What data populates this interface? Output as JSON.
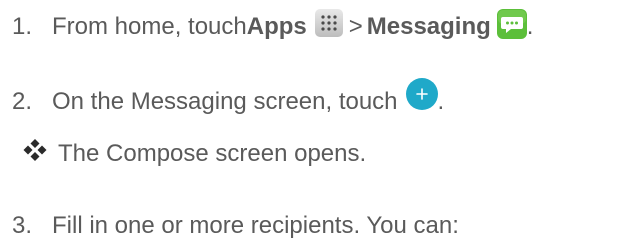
{
  "steps": [
    {
      "number": "1.",
      "text_before": "From home, touch ",
      "bold_1": "Apps",
      "separator": " > ",
      "bold_2": "Messaging",
      "trail": "."
    },
    {
      "number": "2.",
      "text_before": "On the Messaging screen, touch ",
      "trail": "."
    },
    {
      "number": "3.",
      "text": "Fill in one or more recipients. You can:"
    }
  ],
  "bullet": {
    "text": "The Compose screen opens."
  },
  "icons": {
    "apps": "apps-grid-icon",
    "messaging": "messaging-app-icon",
    "compose": "compose-plus-icon",
    "bullet": "diamond-bullet-icon"
  },
  "colors": {
    "text": "#5a5a5a",
    "messaging_green": "#5cbf3a",
    "compose_blue": "#1fa9c9"
  }
}
